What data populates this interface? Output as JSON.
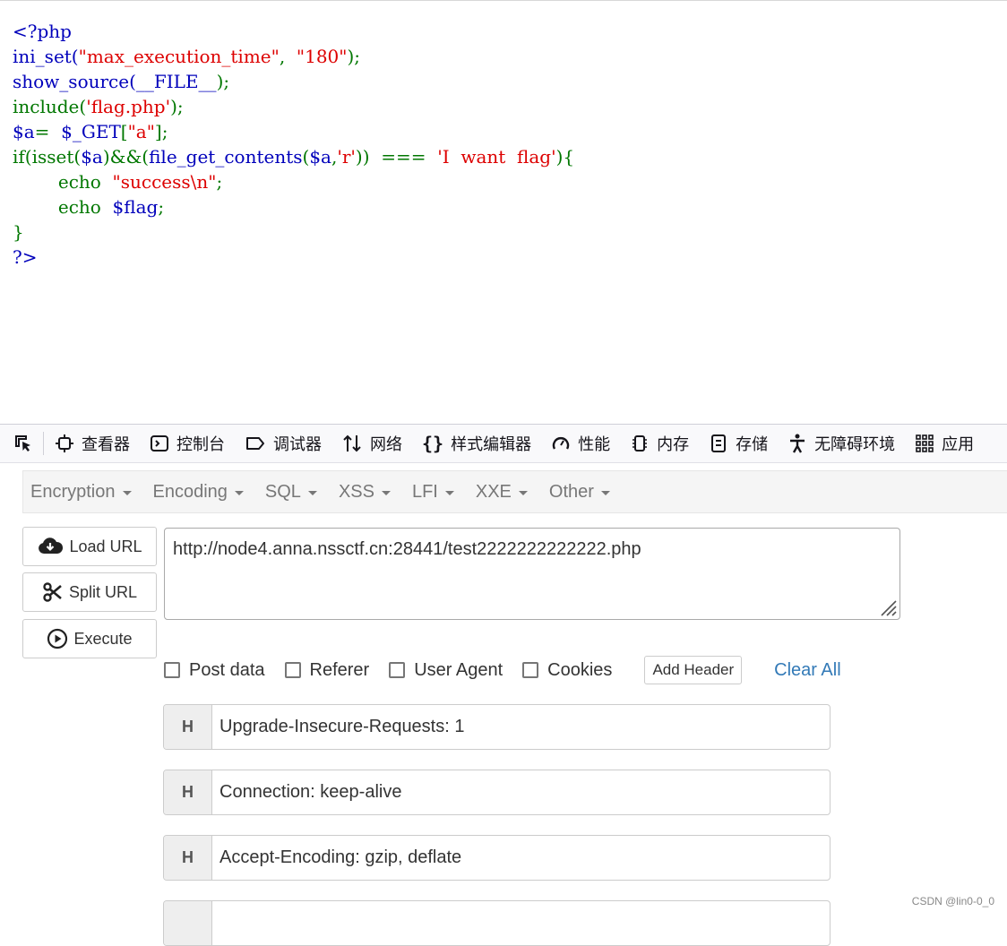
{
  "source_code": {
    "lines": [
      [
        {
          "t": "<?php",
          "c": "def"
        }
      ],
      [
        {
          "t": "ini_set(",
          "c": "def"
        },
        {
          "t": "\"max_execution_time\"",
          "c": "str"
        },
        {
          "t": ",  ",
          "c": "kw"
        },
        {
          "t": "\"180\"",
          "c": "str"
        },
        {
          "t": ");",
          "c": "kw"
        }
      ],
      [
        {
          "t": "show_source(",
          "c": "def"
        },
        {
          "t": "__FILE__",
          "c": "def"
        },
        {
          "t": ");",
          "c": "kw"
        }
      ],
      [
        {
          "t": "include(",
          "c": "kw"
        },
        {
          "t": "'flag.php'",
          "c": "str"
        },
        {
          "t": ");",
          "c": "kw"
        }
      ],
      [
        {
          "t": "$a",
          "c": "def"
        },
        {
          "t": "=  ",
          "c": "kw"
        },
        {
          "t": "$_GET",
          "c": "def"
        },
        {
          "t": "[",
          "c": "kw"
        },
        {
          "t": "\"a\"",
          "c": "str"
        },
        {
          "t": "];",
          "c": "kw"
        }
      ],
      [
        {
          "t": "if(isset(",
          "c": "kw"
        },
        {
          "t": "$a",
          "c": "def"
        },
        {
          "t": ")&&(",
          "c": "kw"
        },
        {
          "t": "file_get_contents",
          "c": "def"
        },
        {
          "t": "(",
          "c": "kw"
        },
        {
          "t": "$a",
          "c": "def"
        },
        {
          "t": ",",
          "c": "kw"
        },
        {
          "t": "'r'",
          "c": "str"
        },
        {
          "t": "))  ===  ",
          "c": "kw"
        },
        {
          "t": "'I  want  flag'",
          "c": "str"
        },
        {
          "t": "){",
          "c": "kw"
        }
      ],
      [
        {
          "t": "        echo  ",
          "c": "kw"
        },
        {
          "t": "\"success\\n\"",
          "c": "str"
        },
        {
          "t": ";",
          "c": "kw"
        }
      ],
      [
        {
          "t": "        echo  ",
          "c": "kw"
        },
        {
          "t": "$flag",
          "c": "def"
        },
        {
          "t": ";",
          "c": "kw"
        }
      ],
      [
        {
          "t": "}",
          "c": "kw"
        }
      ],
      [
        {
          "t": "?>",
          "c": "def"
        }
      ]
    ]
  },
  "devtools": {
    "tabs": [
      {
        "label": "查看器",
        "icon": "inspector-icon"
      },
      {
        "label": "控制台",
        "icon": "console-icon"
      },
      {
        "label": "调试器",
        "icon": "debugger-icon"
      },
      {
        "label": "网络",
        "icon": "network-icon"
      },
      {
        "label": "样式编辑器",
        "icon": "style-editor-icon"
      },
      {
        "label": "性能",
        "icon": "performance-icon"
      },
      {
        "label": "内存",
        "icon": "memory-icon"
      },
      {
        "label": "存储",
        "icon": "storage-icon"
      },
      {
        "label": "无障碍环境",
        "icon": "accessibility-icon"
      },
      {
        "label": "应用",
        "icon": "application-icon"
      }
    ]
  },
  "hackbar": {
    "menu": [
      "Encryption",
      "Encoding",
      "SQL",
      "XSS",
      "LFI",
      "XXE",
      "Other"
    ],
    "buttons": {
      "load_url": "Load URL",
      "split_url": "Split URL",
      "execute": "Execute"
    },
    "url": "http://node4.anna.nssctf.cn:28441/test2222222222222.php",
    "options": {
      "post_data": "Post data",
      "referer": "Referer",
      "user_agent": "User Agent",
      "cookies": "Cookies"
    },
    "add_header": "Add Header",
    "clear_all": "Clear All",
    "header_badge": "H",
    "headers": [
      "Upgrade-Insecure-Requests: 1",
      "Connection: keep-alive",
      "Accept-Encoding: gzip, deflate",
      ""
    ]
  },
  "watermark": "CSDN @lin0-0_0",
  "colors": {
    "php_default": "#0000BB",
    "php_keyword": "#007700",
    "php_string": "#DD0000",
    "link": "#337ab7"
  }
}
